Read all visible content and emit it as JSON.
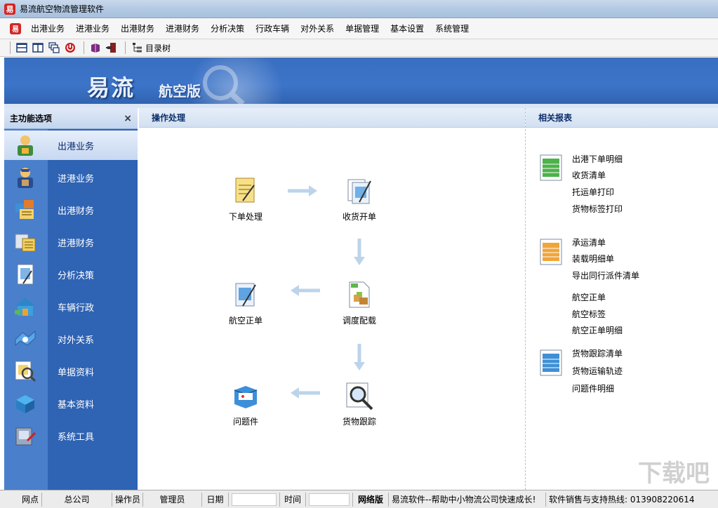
{
  "window": {
    "title": "易流航空物流管理软件"
  },
  "menu": [
    "出港业务",
    "进港业务",
    "出港财务",
    "进港财务",
    "分析决策",
    "行政车辆",
    "对外关系",
    "单据管理",
    "基本设置",
    "系统管理"
  ],
  "toolbar": {
    "directory_tree_label": "目录树"
  },
  "banner": {
    "brand": "易流",
    "edition": "航空版"
  },
  "sidebar": {
    "title": "主功能选项",
    "close": "×",
    "items": [
      {
        "label": "出港业务",
        "icon": "outbound-business-icon",
        "active": true
      },
      {
        "label": "进港业务",
        "icon": "inbound-business-icon",
        "active": false
      },
      {
        "label": "出港财务",
        "icon": "outbound-finance-icon",
        "active": false
      },
      {
        "label": "进港财务",
        "icon": "inbound-finance-icon",
        "active": false
      },
      {
        "label": "分析决策",
        "icon": "analysis-icon",
        "active": false
      },
      {
        "label": "车辆行政",
        "icon": "vehicle-admin-icon",
        "active": false
      },
      {
        "label": "对外关系",
        "icon": "external-relations-icon",
        "active": false
      },
      {
        "label": "单据资料",
        "icon": "documents-icon",
        "active": false
      },
      {
        "label": "基本资料",
        "icon": "basic-data-icon",
        "active": false
      },
      {
        "label": "系统工具",
        "icon": "system-tools-icon",
        "active": false
      }
    ]
  },
  "operations": {
    "title": "操作处理",
    "nodes": {
      "order": "下单处理",
      "receive": "收货开单",
      "airway": "航空正单",
      "dispatch": "调度配载",
      "problem": "问题件",
      "tracking": "货物跟踪"
    }
  },
  "reports": {
    "title": "相关报表",
    "groups": [
      {
        "icon": "green-report-icon",
        "links": [
          "出港下单明细",
          "收货清单",
          "托运单打印",
          "货物标签打印"
        ]
      },
      {
        "icon": "orange-report-icon",
        "links": [
          "承运清单",
          "装载明细单",
          "导出同行派件清单",
          "航空正单",
          "航空标签",
          "航空正单明细"
        ]
      },
      {
        "icon": "blue-report-icon",
        "links": [
          "货物跟踪清单",
          "货物运输轨迹",
          "问题件明细"
        ]
      }
    ]
  },
  "statusbar": {
    "branch_label": "网点",
    "branch_value": "总公司",
    "operator_label": "操作员",
    "operator_value": "管理员",
    "date_label": "日期",
    "time_label": "时间",
    "edition_label": "网络版",
    "slogan": "易流软件--帮助中小物流公司快速成长!",
    "hotline": "软件销售与支持热线: 013908220614"
  },
  "watermark": "下载吧"
}
